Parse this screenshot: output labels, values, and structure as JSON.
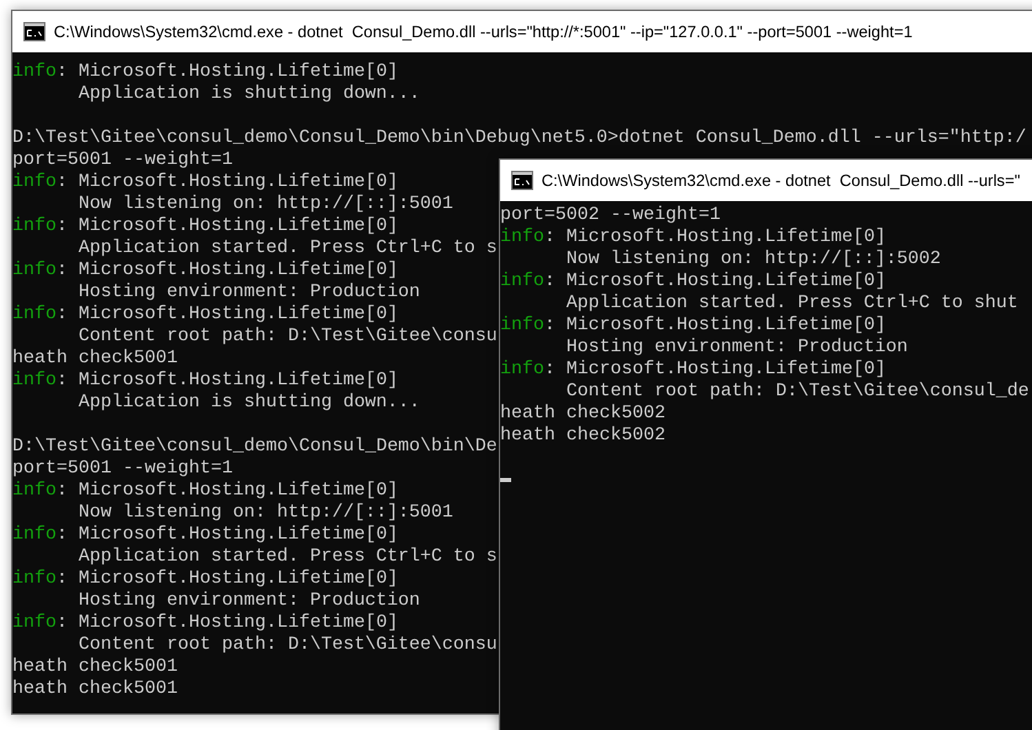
{
  "windows": [
    {
      "title": "C:\\Windows\\System32\\cmd.exe - dotnet  Consul_Demo.dll --urls=\"http://*:5001\" --ip=\"127.0.0.1\" --port=5001 --weight=1",
      "lines": [
        {
          "kind": "log",
          "level": "info",
          "text": ": Microsoft.Hosting.Lifetime[0]"
        },
        {
          "kind": "detail",
          "text": "Application is shutting down..."
        },
        {
          "kind": "blank"
        },
        {
          "kind": "plain",
          "text": "D:\\Test\\Gitee\\consul_demo\\Consul_Demo\\bin\\Debug\\net5.0>dotnet Consul_Demo.dll --urls=\"http:/"
        },
        {
          "kind": "plain",
          "text": "port=5001 --weight=1"
        },
        {
          "kind": "log",
          "level": "info",
          "text": ": Microsoft.Hosting.Lifetime[0]"
        },
        {
          "kind": "detail",
          "text": "Now listening on: http://[::]:5001"
        },
        {
          "kind": "log",
          "level": "info",
          "text": ": Microsoft.Hosting.Lifetime[0]"
        },
        {
          "kind": "detail",
          "text": "Application started. Press Ctrl+C to s"
        },
        {
          "kind": "log",
          "level": "info",
          "text": ": Microsoft.Hosting.Lifetime[0]"
        },
        {
          "kind": "detail",
          "text": "Hosting environment: Production"
        },
        {
          "kind": "log",
          "level": "info",
          "text": ": Microsoft.Hosting.Lifetime[0]"
        },
        {
          "kind": "detail",
          "text": "Content root path: D:\\Test\\Gitee\\consu"
        },
        {
          "kind": "plain",
          "text": "heath check5001"
        },
        {
          "kind": "log",
          "level": "info",
          "text": ": Microsoft.Hosting.Lifetime[0]"
        },
        {
          "kind": "detail",
          "text": "Application is shutting down..."
        },
        {
          "kind": "blank"
        },
        {
          "kind": "plain",
          "text": "D:\\Test\\Gitee\\consul_demo\\Consul_Demo\\bin\\De"
        },
        {
          "kind": "plain",
          "text": "port=5001 --weight=1"
        },
        {
          "kind": "log",
          "level": "info",
          "text": ": Microsoft.Hosting.Lifetime[0]"
        },
        {
          "kind": "detail",
          "text": "Now listening on: http://[::]:5001"
        },
        {
          "kind": "log",
          "level": "info",
          "text": ": Microsoft.Hosting.Lifetime[0]"
        },
        {
          "kind": "detail",
          "text": "Application started. Press Ctrl+C to s"
        },
        {
          "kind": "log",
          "level": "info",
          "text": ": Microsoft.Hosting.Lifetime[0]"
        },
        {
          "kind": "detail",
          "text": "Hosting environment: Production"
        },
        {
          "kind": "log",
          "level": "info",
          "text": ": Microsoft.Hosting.Lifetime[0]"
        },
        {
          "kind": "detail",
          "text": "Content root path: D:\\Test\\Gitee\\consu"
        },
        {
          "kind": "plain",
          "text": "heath check5001"
        },
        {
          "kind": "plain",
          "text": "heath check5001"
        }
      ]
    },
    {
      "title": "C:\\Windows\\System32\\cmd.exe - dotnet  Consul_Demo.dll --urls=\"",
      "cursor": true,
      "lines": [
        {
          "kind": "plain",
          "text": "port=5002 --weight=1"
        },
        {
          "kind": "log",
          "level": "info",
          "text": ": Microsoft.Hosting.Lifetime[0]"
        },
        {
          "kind": "detail",
          "text": "Now listening on: http://[::]:5002"
        },
        {
          "kind": "log",
          "level": "info",
          "text": ": Microsoft.Hosting.Lifetime[0]"
        },
        {
          "kind": "detail",
          "text": "Application started. Press Ctrl+C to shut"
        },
        {
          "kind": "log",
          "level": "info",
          "text": ": Microsoft.Hosting.Lifetime[0]"
        },
        {
          "kind": "detail",
          "text": "Hosting environment: Production"
        },
        {
          "kind": "log",
          "level": "info",
          "text": ": Microsoft.Hosting.Lifetime[0]"
        },
        {
          "kind": "detail",
          "text": "Content root path: D:\\Test\\Gitee\\consul_de"
        },
        {
          "kind": "plain",
          "text": "heath check5002"
        },
        {
          "kind": "plain",
          "text": "heath check5002"
        },
        {
          "kind": "blank"
        }
      ]
    }
  ]
}
